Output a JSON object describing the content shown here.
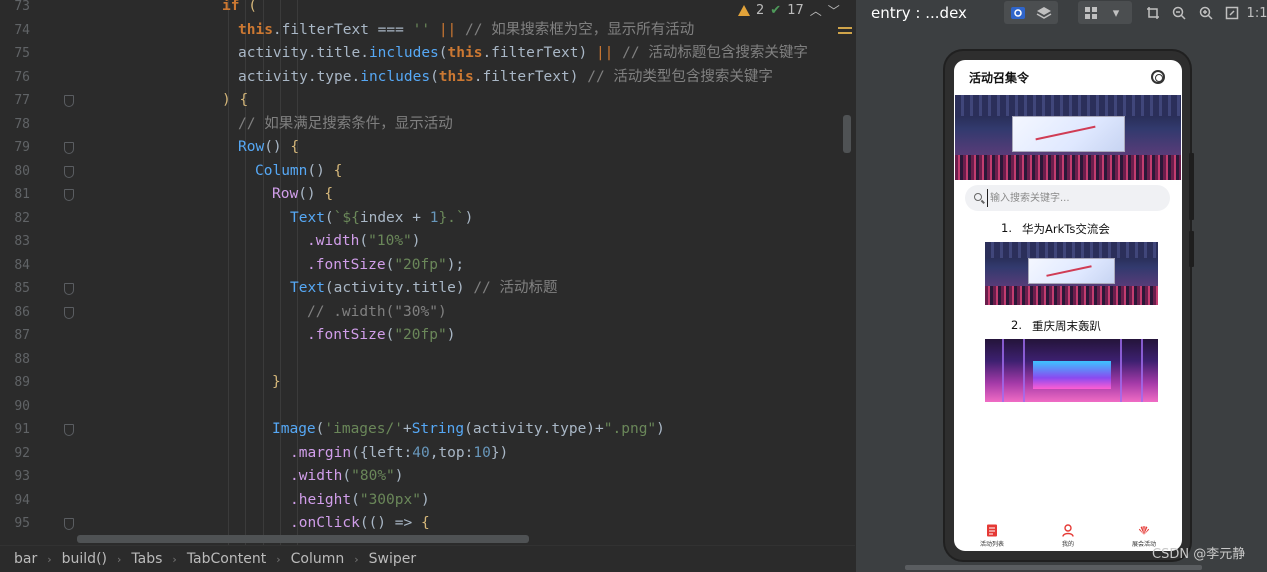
{
  "editor": {
    "line_numbers": [
      "73",
      "74",
      "75",
      "76",
      "77",
      "78",
      "79",
      "80",
      "81",
      "82",
      "83",
      "84",
      "85",
      "86",
      "87",
      "88",
      "89",
      "90",
      "91",
      "92",
      "93",
      "94",
      "95"
    ],
    "inspections": {
      "warnings": "2",
      "checks": "17"
    }
  },
  "breadcrumb": [
    "bar",
    "build()",
    "Tabs",
    "TabContent",
    "Column",
    "Swiper"
  ],
  "previewer": {
    "title": "entry : ...dex",
    "zoom_ratio": "1:1",
    "watermark": "CSDN @李元静"
  },
  "app": {
    "title": "活动召集令",
    "search_placeholder": "输入搜索关键字...",
    "activities": [
      {
        "index": "1.",
        "title": "华为ArkTs交流会"
      },
      {
        "index": "2.",
        "title": "重庆周末轰趴"
      }
    ],
    "tabs": [
      {
        "label": "活动列表",
        "color": "#e53935"
      },
      {
        "label": "我的",
        "color": "#e53935"
      },
      {
        "label": "展会活动",
        "color": "#e53935"
      }
    ]
  }
}
